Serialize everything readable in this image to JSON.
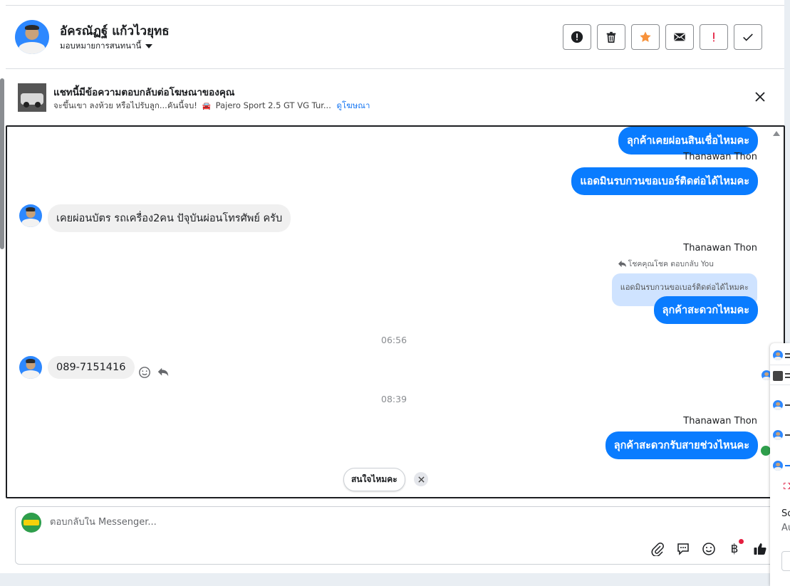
{
  "header": {
    "contact_name": "อัครณัฏฐ์ แก้วไวยุทธ",
    "assignee_label": "มอบหมายการสนทนานี้",
    "actions": [
      "report",
      "delete",
      "star",
      "mark-unread",
      "important",
      "done"
    ]
  },
  "ad": {
    "title": "แชทนี้มีข้อความตอบกลับต่อโฆษณาของคุณ",
    "description": "จะขึ้นเขา ลงห้วย หรือไปรับลูก...คันนี้จบ!",
    "product": "Pajero Sport 2.5 GT VG Tur...",
    "view_link": "ดูโฆษณา"
  },
  "messages": {
    "m1": {
      "text": "ลุกค้าเคยผ่อนสินเชื่อไหมคะ"
    },
    "m2": {
      "sender": "Thanawan Thon",
      "text": "แอดมินรบกวนขอเบอร์ติดต่อได้ไหมคะ"
    },
    "m3": {
      "text": "เคยผ่อนบัตร รถเครื่อง2คน ปัจุบันผ่อนโทรศัพย์ ครับ"
    },
    "m4": {
      "sender": "Thanawan Thon",
      "reply_note": "โชคคุณโชค ตอบกลับ You",
      "quoted": "แอดมินรบกวนขอเบอร์ติดต่อได้ไหมคะ",
      "text": "ลุกค้าสะดวกไหมคะ"
    },
    "time1": "06:56",
    "m5": {
      "text": "089-7151416"
    },
    "time2": "08:39",
    "m6": {
      "sender": "Thanawan Thon",
      "text": "ลุกค้าสะดวกรับสายช่วงไหนคะ"
    }
  },
  "suggestion": {
    "label": "สนใจไหมคะ"
  },
  "composer": {
    "placeholder": "ตอบกลับใน Messenger...",
    "baht_symbol": "฿"
  },
  "side_panel": {
    "text1": "Sc",
    "text2": "Au"
  },
  "colors": {
    "outgoing_bubble": "#0a7cff",
    "incoming_bubble": "#f0f0f0",
    "star": "#f7923b",
    "important": "#e41e3f",
    "link": "#1877f2"
  }
}
